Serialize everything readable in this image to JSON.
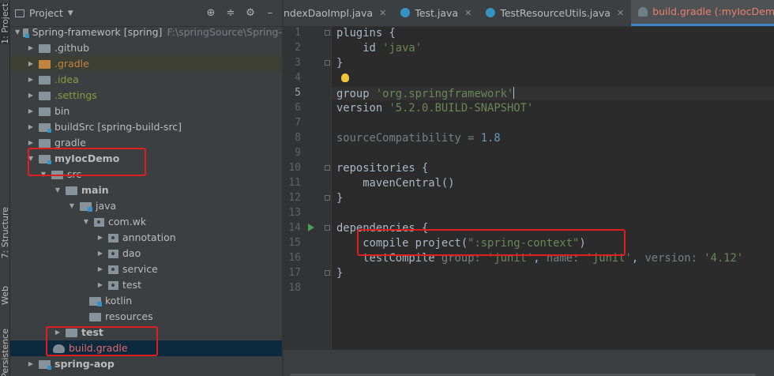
{
  "left_strip": {
    "tabs": [
      "1: Project",
      "7: Structure",
      "Web",
      "Persistence"
    ]
  },
  "project_panel": {
    "title": "Project",
    "actions": [
      "target-icon",
      "collapse-icon",
      "gear-icon",
      "minimize-icon"
    ],
    "tree": [
      {
        "label": "Spring-framework [spring]",
        "path": "F:\\springSource\\Spring-",
        "icon": "module",
        "bold": true
      },
      {
        "label": ".github",
        "icon": "folder"
      },
      {
        "label": ".gradle",
        "icon": "folder-orange"
      },
      {
        "label": ".idea",
        "icon": "folder"
      },
      {
        "label": ".settings",
        "icon": "folder"
      },
      {
        "label": "bin",
        "icon": "folder"
      },
      {
        "label": "buildSrc [spring-build-src]",
        "icon": "module"
      },
      {
        "label": "gradle",
        "icon": "folder"
      },
      {
        "label": "myIocDemo",
        "icon": "module"
      },
      {
        "label": "src",
        "icon": "folder"
      },
      {
        "label": "main",
        "icon": "folder"
      },
      {
        "label": "java",
        "icon": "source-folder"
      },
      {
        "label": "com.wk",
        "icon": "package"
      },
      {
        "label": "annotation",
        "icon": "package"
      },
      {
        "label": "dao",
        "icon": "package"
      },
      {
        "label": "service",
        "icon": "package"
      },
      {
        "label": "test",
        "icon": "package"
      },
      {
        "label": "kotlin",
        "icon": "source-folder"
      },
      {
        "label": "resources",
        "icon": "folder"
      },
      {
        "label": "test",
        "icon": "folder"
      },
      {
        "label": "build.gradle",
        "icon": "gradle-elephant"
      },
      {
        "label": "spring-aop",
        "icon": "module"
      }
    ]
  },
  "editor_tabs": [
    {
      "label": "ndexDaoImpl.java",
      "icon": "java-class-icon",
      "active": false
    },
    {
      "label": "Test.java",
      "icon": "java-class-icon",
      "active": false
    },
    {
      "label": "TestResourceUtils.java",
      "icon": "java-class-icon",
      "active": false
    },
    {
      "label": "build.gradle (:myIocDemo)",
      "icon": "gradle-icon",
      "active": true
    }
  ],
  "editor": {
    "line_numbers": [
      "1",
      "2",
      "3",
      "4",
      "5",
      "6",
      "7",
      "8",
      "9",
      "10",
      "11",
      "12",
      "13",
      "14",
      "15",
      "16",
      "17",
      "18"
    ],
    "current_line": "5",
    "lines": {
      "l1": "plugins {",
      "l2_kw": "    id ",
      "l2_str": "'java'",
      "l3": "}",
      "l5_kw": "group ",
      "l5_str": "'org.springframework'",
      "l6_kw": "version ",
      "l6_str": "'5.2.0.BUILD-SNAPSHOT'",
      "l8_kw": "sourceCompatibility = ",
      "l8_num": "1.8",
      "l10": "repositories {",
      "l11": "    mavenCentral()",
      "l12": "}",
      "l14": "dependencies {",
      "l15_a": "    compile project(",
      "l15_str": "\":spring-context\"",
      "l15_b": ")",
      "l16_a": "    testCompile ",
      "l16_g": "group: ",
      "l16_gv": "'junit'",
      "l16_sep1": ", ",
      "l16_n": "name: ",
      "l16_nv": "'junit'",
      "l16_sep2": ", ",
      "l16_v": "version: ",
      "l16_vv": "'4.12'",
      "l17": "}"
    }
  },
  "colors": {
    "annotation_red": "#e01e1e",
    "string_green": "#6a8759",
    "number_blue": "#6897bb",
    "active_tab_text": "#e8816c"
  }
}
